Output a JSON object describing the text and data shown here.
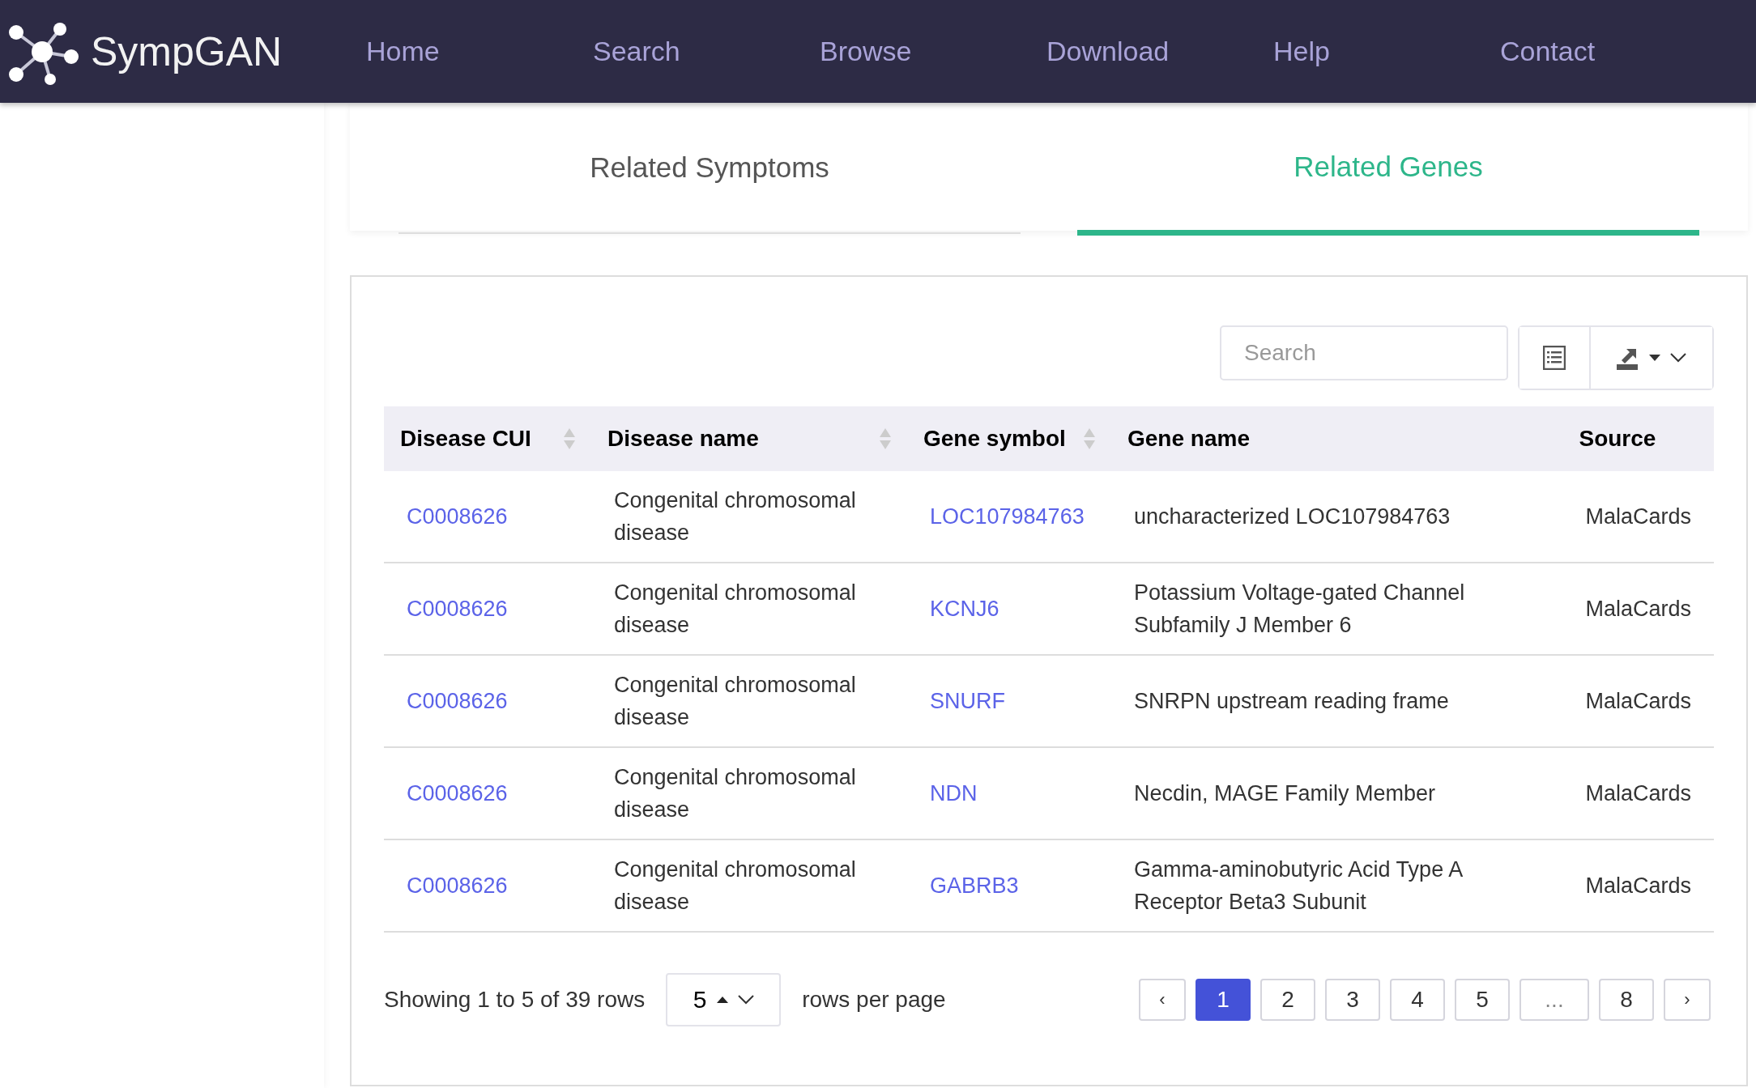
{
  "header": {
    "brand": "SympGAN",
    "nav": [
      {
        "label": "Home"
      },
      {
        "label": "Search"
      },
      {
        "label": "Browse"
      },
      {
        "label": "Download"
      },
      {
        "label": "Help"
      },
      {
        "label": "Contact"
      }
    ]
  },
  "tabs": [
    {
      "label": "Related Symptoms",
      "selected": false
    },
    {
      "label": "Related Genes",
      "selected": true
    }
  ],
  "toolbar": {
    "search": {
      "placeholder": "Search"
    }
  },
  "table": {
    "columns": [
      {
        "label": "Disease CUI",
        "sortable": true
      },
      {
        "label": "Disease name",
        "sortable": true
      },
      {
        "label": "Gene symbol",
        "sortable": true
      },
      {
        "label": "Gene name",
        "sortable": false
      },
      {
        "label": "Source",
        "sortable": false
      }
    ],
    "rows": [
      {
        "cui": "C0008626",
        "disease": "Congenital chromosomal disease",
        "symbol": "LOC107984763",
        "gene": "uncharacterized LOC107984763",
        "source": "MalaCards"
      },
      {
        "cui": "C0008626",
        "disease": "Congenital chromosomal disease",
        "symbol": "KCNJ6",
        "gene": "Potassium Voltage-gated Channel Subfamily J Member 6",
        "source": "MalaCards"
      },
      {
        "cui": "C0008626",
        "disease": "Congenital chromosomal disease",
        "symbol": "SNURF",
        "gene": "SNRPN upstream reading frame",
        "source": "MalaCards"
      },
      {
        "cui": "C0008626",
        "disease": "Congenital chromosomal disease",
        "symbol": "NDN",
        "gene": "Necdin, MAGE Family Member",
        "source": "MalaCards"
      },
      {
        "cui": "C0008626",
        "disease": "Congenital chromosomal disease",
        "symbol": "GABRB3",
        "gene": "Gamma-aminobutyric Acid Type A Receptor Beta3 Subunit",
        "source": "MalaCards"
      }
    ]
  },
  "pagination": {
    "summary": "Showing 1 to 5 of 39 rows",
    "page_size": "5",
    "page_size_suffix": "rows per page",
    "pages": [
      {
        "label": "‹",
        "kind": "prev",
        "selected": false
      },
      {
        "label": "1",
        "kind": "page",
        "selected": true
      },
      {
        "label": "2",
        "kind": "page",
        "selected": false
      },
      {
        "label": "3",
        "kind": "page",
        "selected": false
      },
      {
        "label": "4",
        "kind": "page",
        "selected": false
      },
      {
        "label": "5",
        "kind": "page",
        "selected": false
      },
      {
        "label": "...",
        "kind": "gap",
        "selected": false
      },
      {
        "label": "8",
        "kind": "page",
        "selected": false
      },
      {
        "label": "›",
        "kind": "next",
        "selected": false
      }
    ]
  }
}
